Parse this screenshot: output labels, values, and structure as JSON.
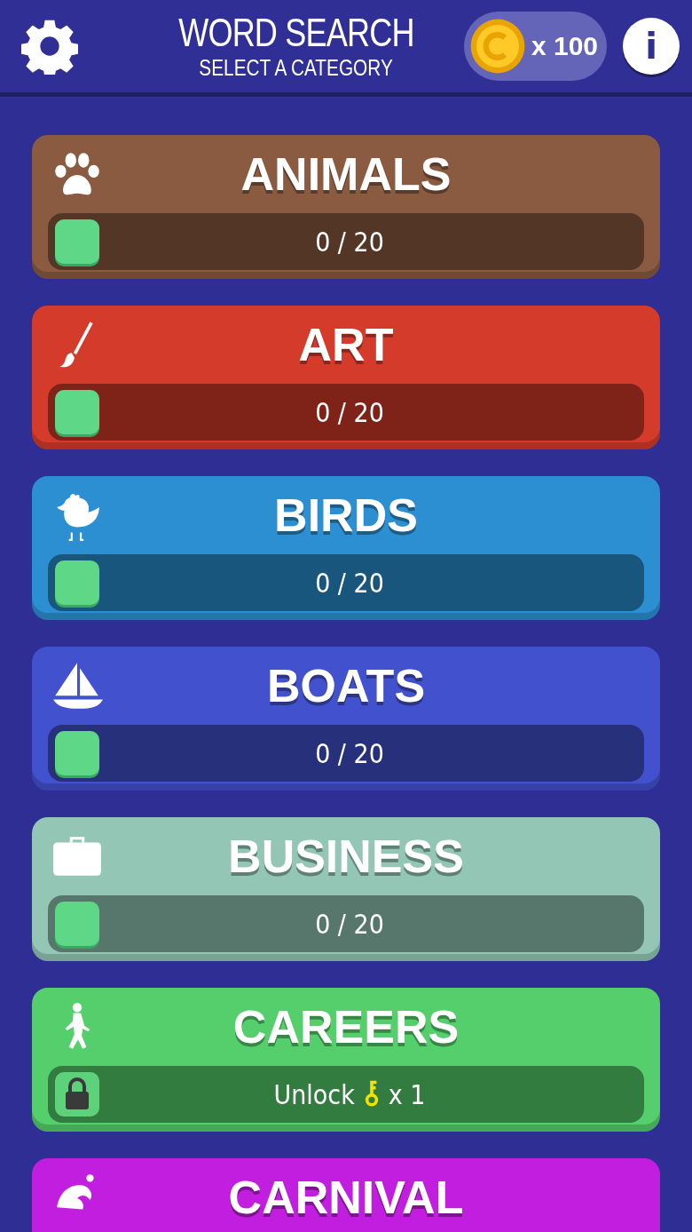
{
  "header": {
    "title": "WORD SEARCH",
    "subtitle": "SELECT A CATEGORY",
    "coins": "x 100",
    "info": "i"
  },
  "categories": [
    {
      "name": "ANIMALS",
      "color": "#8a5b40",
      "kind": "progress",
      "level": 0,
      "progress": "0 / 20"
    },
    {
      "name": "ART",
      "color": "#d43b2b",
      "kind": "progress",
      "level": 0,
      "progress": "0 / 20"
    },
    {
      "name": "BIRDS",
      "color": "#2b8fd2",
      "kind": "progress",
      "level": 0,
      "progress": "0 / 20"
    },
    {
      "name": "BOATS",
      "color": "#4251cd",
      "kind": "progress",
      "level": 0,
      "progress": "0 / 20"
    },
    {
      "name": "BUSINESS",
      "color": "#93c6b4",
      "kind": "progress",
      "level": 0,
      "progress": "0 / 20"
    },
    {
      "name": "CAREERS",
      "color": "#55cf6b",
      "kind": "locked",
      "unlock": "Unlock",
      "cost": "x 1"
    },
    {
      "name": "CARNIVAL",
      "color": "#c21ee0",
      "kind": "cut"
    }
  ]
}
